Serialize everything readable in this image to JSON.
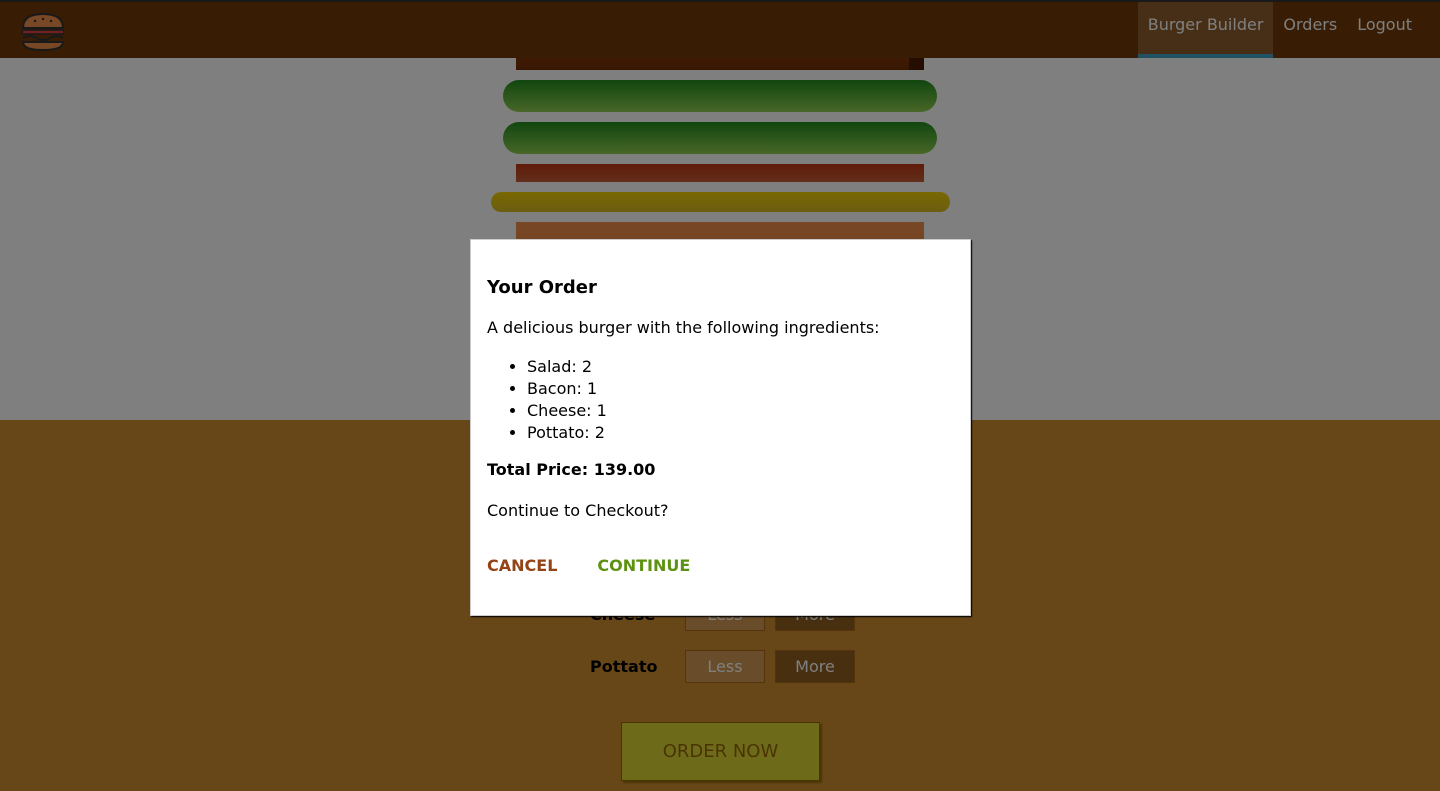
{
  "nav": {
    "items": [
      {
        "label": "Burger Builder",
        "active": true
      },
      {
        "label": "Orders",
        "active": false
      },
      {
        "label": "Logout",
        "active": false
      }
    ]
  },
  "controls": [
    {
      "label": "Cheese",
      "less": "Less",
      "more": "More"
    },
    {
      "label": "Pottato",
      "less": "Less",
      "more": "More"
    }
  ],
  "order_button": "ORDER NOW",
  "modal": {
    "title": "Your Order",
    "intro": "A delicious burger with the following ingredients:",
    "ingredients": [
      "Salad: 2",
      "Bacon: 1",
      "Cheese: 1",
      "Pottato: 2"
    ],
    "total_label": "Total Price: 139.00",
    "question": "Continue to Checkout?",
    "cancel": "CANCEL",
    "continue": "CONTINUE"
  },
  "colors": {
    "toolbar": "#703B09",
    "controls_bg": "#CF8F2E",
    "cancel": "#944317",
    "continue": "#5C9210",
    "active_underline": "#40A4C8"
  }
}
